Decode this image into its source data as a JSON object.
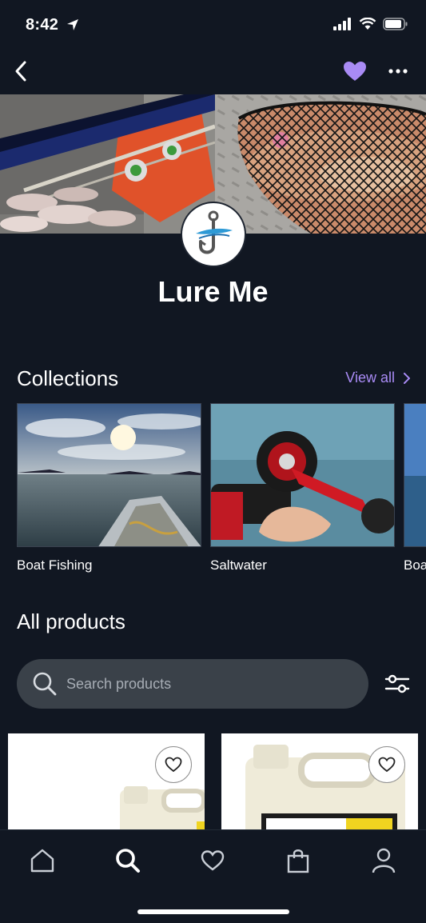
{
  "status_bar": {
    "time": "8:42"
  },
  "store": {
    "name": "Lure Me"
  },
  "collections": {
    "title": "Collections",
    "view_all_label": "View all",
    "items": [
      {
        "label": "Boat Fishing"
      },
      {
        "label": "Saltwater"
      },
      {
        "label": "Boa"
      }
    ]
  },
  "products": {
    "title": "All products",
    "search_placeholder": "Search products"
  },
  "colors": {
    "background": "#111722",
    "accent": "#a98bf5",
    "search_bg": "#3a4149"
  },
  "icons": {
    "back": "chevron-left-icon",
    "favorite": "heart-icon",
    "more": "ellipsis-icon",
    "search": "search-icon",
    "filter": "sliders-icon",
    "tabs": [
      "home-icon",
      "search-icon",
      "heart-icon",
      "bag-icon",
      "user-icon"
    ]
  }
}
